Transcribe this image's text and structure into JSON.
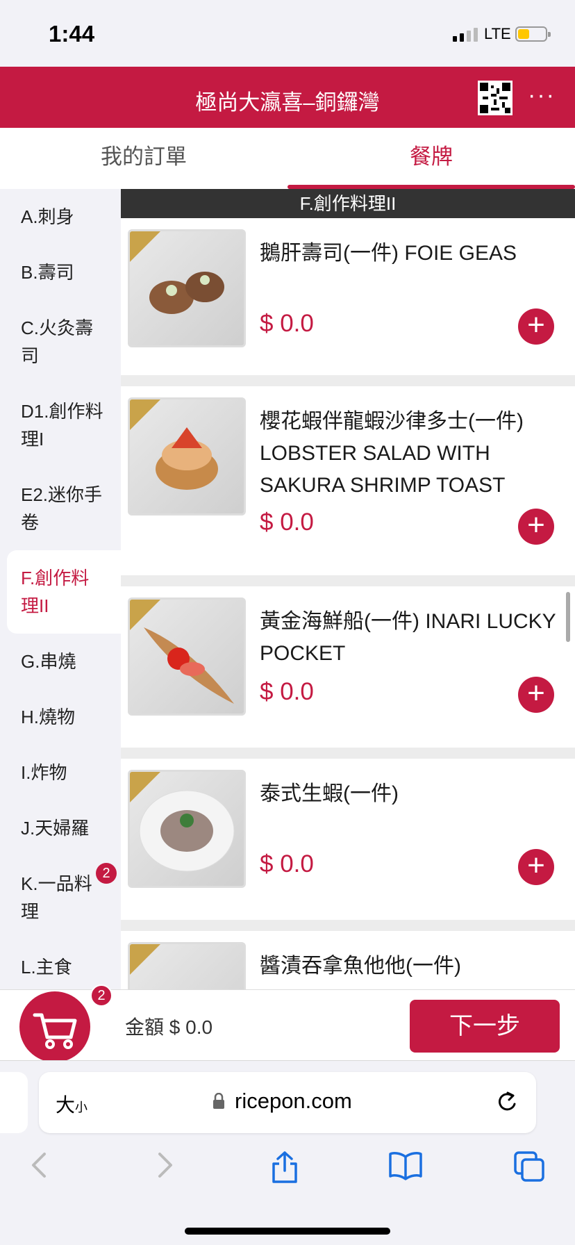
{
  "status": {
    "time": "1:44",
    "network": "LTE"
  },
  "header": {
    "title": "極尚大瀛喜–銅鑼灣",
    "more": "···"
  },
  "tabs": [
    {
      "label": "我的訂單",
      "active": false
    },
    {
      "label": "餐牌",
      "active": true
    }
  ],
  "sidebar": {
    "categories": [
      {
        "label": "A.刺身"
      },
      {
        "label": "B.壽司"
      },
      {
        "label": "C.火灸壽司"
      },
      {
        "label": "D1.創作料理I"
      },
      {
        "label": "E2.迷你手卷"
      },
      {
        "label": "F.創作料理II",
        "active": true
      },
      {
        "label": "G.串燒"
      },
      {
        "label": "H.燒物"
      },
      {
        "label": "I.炸物"
      },
      {
        "label": "J.天婦羅"
      },
      {
        "label": "K.一品料理",
        "badge": "2"
      },
      {
        "label": "L.主食"
      }
    ]
  },
  "menu": {
    "section_title": "F.創作料理II",
    "items": [
      {
        "name": "鵝肝壽司(一件) FOIE GEAS",
        "price": "$ 0.0",
        "add": "+"
      },
      {
        "name": "櫻花蝦伴龍蝦沙律多士(一件) LOBSTER SALAD WITH SAKURA SHRIMP TOAST",
        "price": "$ 0.0",
        "add": "+"
      },
      {
        "name": "黃金海鮮船(一件) INARI LUCKY POCKET",
        "price": "$ 0.0",
        "add": "+"
      },
      {
        "name": "泰式生蝦(一件)",
        "price": "$ 0.0",
        "add": "+"
      },
      {
        "name": "醬漬吞拿魚他他(一件)",
        "price": "",
        "add": ""
      }
    ]
  },
  "cart": {
    "badge": "2",
    "amount_label": "金額 $ 0.0",
    "next_label": "下一步"
  },
  "browser": {
    "text_size_label": "大",
    "text_size_small": "小",
    "url": "ricepon.com"
  },
  "colors": {
    "brand": "#c41a42",
    "section_header": "#333333",
    "gold_corner": "#c9a34a"
  }
}
